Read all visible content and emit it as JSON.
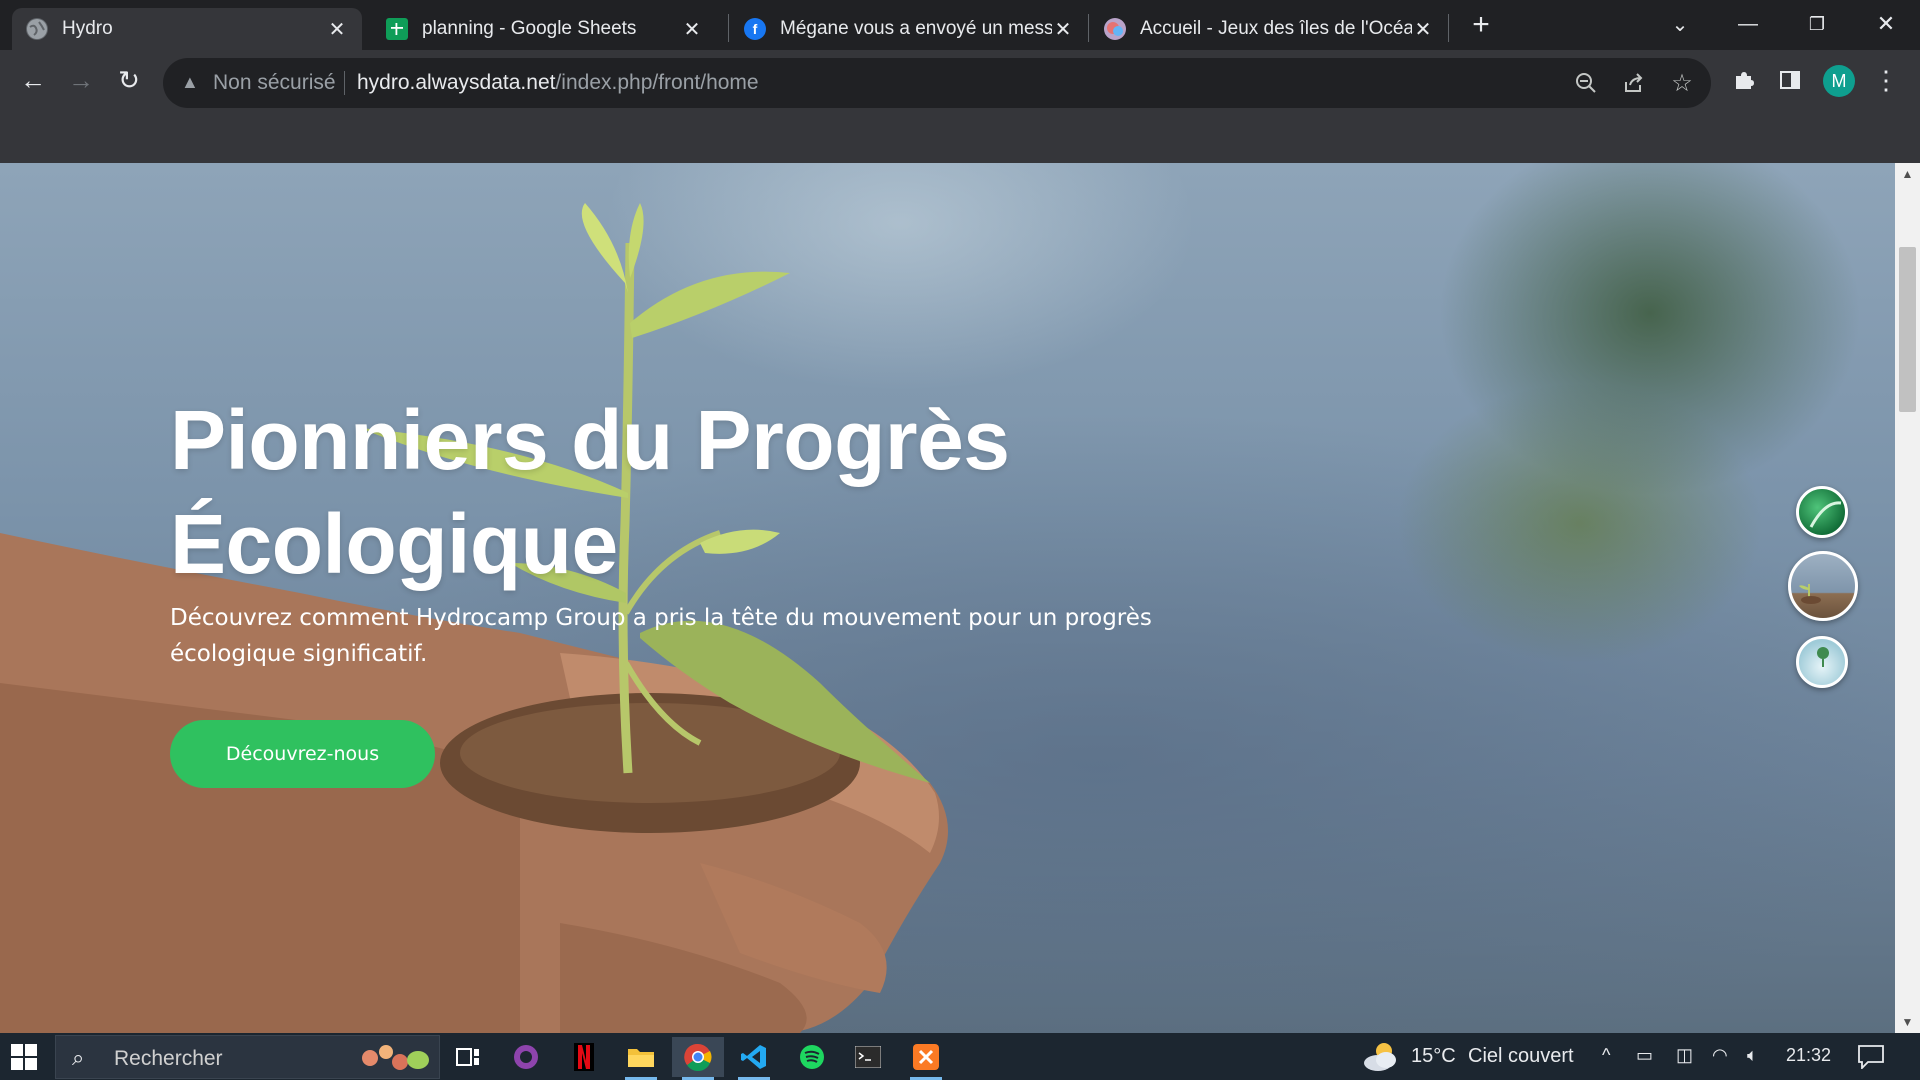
{
  "browser": {
    "tabs": [
      {
        "title": "Hydro",
        "active": true,
        "favicon": "globe-icon"
      },
      {
        "title": "planning - Google Sheets",
        "active": false,
        "favicon": "google-sheets-icon"
      },
      {
        "title": "Mégane vous a envoyé un message",
        "active": false,
        "favicon": "facebook-icon"
      },
      {
        "title": "Accueil - Jeux des îles de l'Océan Indien",
        "active": false,
        "favicon": "jeux-iles-icon"
      }
    ],
    "security_label": "Non sécurisé",
    "url_host": "hydro.alwaysdata.net",
    "url_path": "/index.php/front/home",
    "profile_initial": "M",
    "accent": "#35363a"
  },
  "hero": {
    "title_line1": "Pionniers du Progrès",
    "title_line2": "Écologique",
    "subtitle": "Découvrez comment Hydrocamp Group a pris la tête du mouvement pour un progrès écologique significatif.",
    "cta_label": "Découvrez-nous",
    "cta_color": "#2fc15f",
    "slides": [
      "green-leaf-thumbnail",
      "seedling-hands-thumbnail",
      "globe-plant-thumbnail"
    ],
    "active_slide": 2
  },
  "taskbar": {
    "search_placeholder": "Rechercher",
    "apps": [
      "task-view-icon",
      "github-desktop-icon",
      "netflix-icon",
      "file-explorer-icon",
      "chrome-icon",
      "vscode-icon",
      "spotify-icon",
      "terminal-icon",
      "xampp-icon"
    ],
    "weather_temp": "15°C",
    "weather_text": "Ciel couvert",
    "time": "21:32"
  }
}
